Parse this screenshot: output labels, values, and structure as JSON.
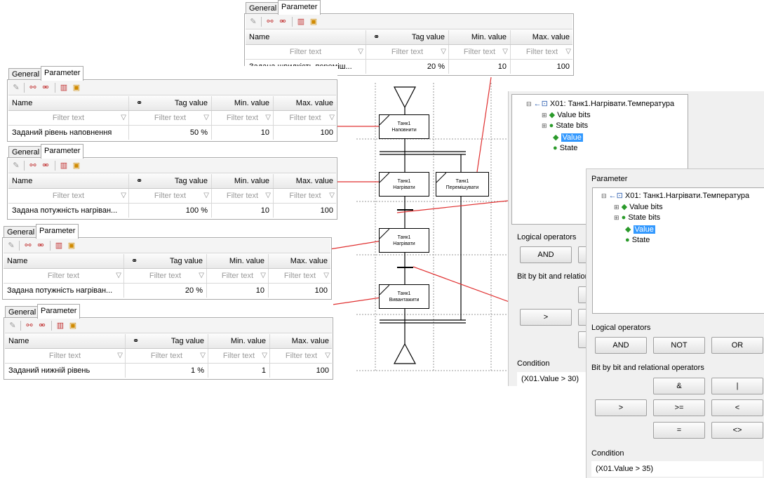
{
  "tabs": {
    "general": "General",
    "parameter": "Parameter"
  },
  "columns": {
    "name": "Name",
    "tag_value": "Tag value",
    "min_value": "Min. value",
    "max_value": "Max. value"
  },
  "filter_placeholder": "Filter text",
  "panels": [
    {
      "name": "Задана швидкість переміш...",
      "tag_value": "20 %",
      "min": "10",
      "max": "100"
    },
    {
      "name": "Заданий рівень наповнення",
      "tag_value": "50 %",
      "min": "10",
      "max": "100"
    },
    {
      "name": "Задана потужність нагріван...",
      "tag_value": "100 %",
      "min": "10",
      "max": "100"
    },
    {
      "name": "Задана потужність нагріван...",
      "tag_value": "20 %",
      "min": "10",
      "max": "100"
    },
    {
      "name": "Заданий нижній рівень",
      "tag_value": "1 %",
      "min": "1",
      "max": "100"
    }
  ],
  "steps": [
    {
      "line1": "Танк1",
      "line2": "Наповнити"
    },
    {
      "line1": "Танк1",
      "line2": "Нагрівати"
    },
    {
      "line1": "Танк1",
      "line2": "Перемішувати"
    },
    {
      "line1": "Танк1",
      "line2": "Нагрівати"
    },
    {
      "line1": "Танк1",
      "line2": "Вивантажити"
    }
  ],
  "dialog_back": {
    "tree_root": "X01: Танк1.Нагрівати.Температура",
    "tree_items": [
      "Value bits",
      "State bits",
      "Value",
      "State"
    ],
    "logical_label": "Logical operators",
    "and": "AND",
    "bitwise_label": "Bit by bit and relational operators",
    "gt": ">",
    "condition_label": "Condition",
    "condition": "(X01.Value > 30)"
  },
  "dialog_front": {
    "section_label": "Parameter",
    "tree_root": "X01: Танк1.Нагрівати.Температура",
    "tree_items": [
      "Value bits",
      "State bits",
      "Value",
      "State"
    ],
    "logical_label": "Logical operators",
    "logical_ops": [
      "AND",
      "NOT",
      "OR"
    ],
    "bitwise_label": "Bit by bit and relational operators",
    "ops_row1": [
      "&",
      "|"
    ],
    "ops_row2": [
      ">",
      ">=",
      "<"
    ],
    "ops_row3": [
      "=",
      "<>"
    ],
    "condition_label": "Condition",
    "condition": "(X01.Value > 35)"
  }
}
